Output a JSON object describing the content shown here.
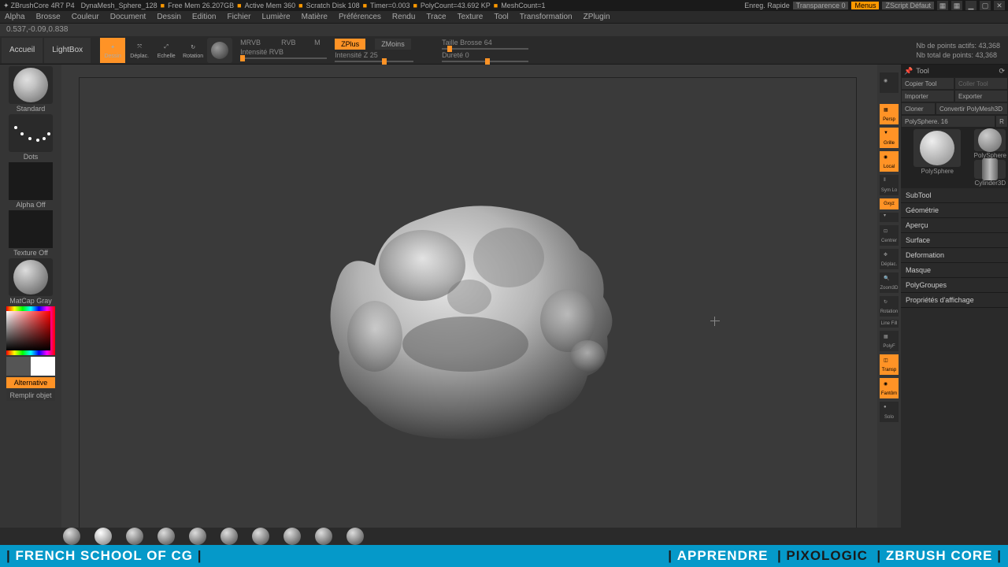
{
  "title": {
    "app": "ZBrushCore 4R7 P4",
    "doc": "DynaMesh_Sphere_128",
    "freemem": "Free Mem 26.207GB",
    "activemem": "Active Mem 360",
    "scratch": "Scratch Disk 108",
    "timer": "Timer=0.003",
    "polycount": "PolyCount=43.692 KP",
    "meshcount": "MeshCount=1"
  },
  "topright": {
    "enreg": "Enreg. Rapide",
    "trans": "Transparence 0",
    "menus": "Menus",
    "zscript": "ZScript Défaut"
  },
  "menu": [
    "Alpha",
    "Brosse",
    "Couleur",
    "Document",
    "Dessin",
    "Edition",
    "Fichier",
    "Lumière",
    "Matière",
    "Préférences",
    "Rendu",
    "Trace",
    "Texture",
    "Tool",
    "Transformation",
    "ZPlugin"
  ],
  "coords": "0.537,-0.09,0.838",
  "toolbar": {
    "accueil": "Accueil",
    "lightbox": "LightBox",
    "dessin": "Dessin",
    "deplac": "Déplac.",
    "echelle": "Echelle",
    "rotation": "Rotation"
  },
  "sliders": {
    "mrvb": "MRVB",
    "rvb": "RVB",
    "m": "M",
    "irvb": "Intensité RVB",
    "zplus": "ZPlus",
    "zmoins": "ZMoins",
    "iz": "Intensité Z 25",
    "taille": "Taille Brosse 64",
    "durete": "Dureté 0"
  },
  "stats": {
    "actifs": "Nb de points actifs: 43,368",
    "total": "Nb total de points: 43,368"
  },
  "left": {
    "brush": "Standard",
    "stroke": "Dots",
    "alpha": "Alpha Off",
    "texture": "Texture Off",
    "material": "MatCap Gray",
    "alt": "Alternative",
    "fill": "Remplir objet"
  },
  "rshelf": [
    "",
    "Persp",
    "Grille",
    "Local",
    "Sym Lo",
    "Gxyz",
    "",
    "Centrer",
    "Déplac.",
    "Zoom3D",
    "Rotation",
    "Line Fill",
    "PolyF",
    "Transp",
    "Fantôm",
    "Solo"
  ],
  "rp": {
    "title": "Tool",
    "copy": "Copier Tool",
    "paste": "Coller Tool",
    "import": "Importer",
    "export": "Exporter",
    "clone": "Cloner",
    "convert": "Convertir PolyMesh3D",
    "ps": "PolySphere. 16",
    "r": "R",
    "thumb1": "PolySphere",
    "thumb2": "PolySphere",
    "thumb3": "Cylinder3D"
  },
  "sections": [
    "SubTool",
    "Géométrie",
    "Aperçu",
    "Surface",
    "Deformation",
    "Masque",
    "PolyGroupes",
    "Propriétés d'affichage"
  ],
  "footer": {
    "left": "FRENCH SCHOOL OF CG",
    "r1": "APPRENDRE",
    "r2": "PIXOLOGIC",
    "r3": "ZBRUSH CORE"
  }
}
